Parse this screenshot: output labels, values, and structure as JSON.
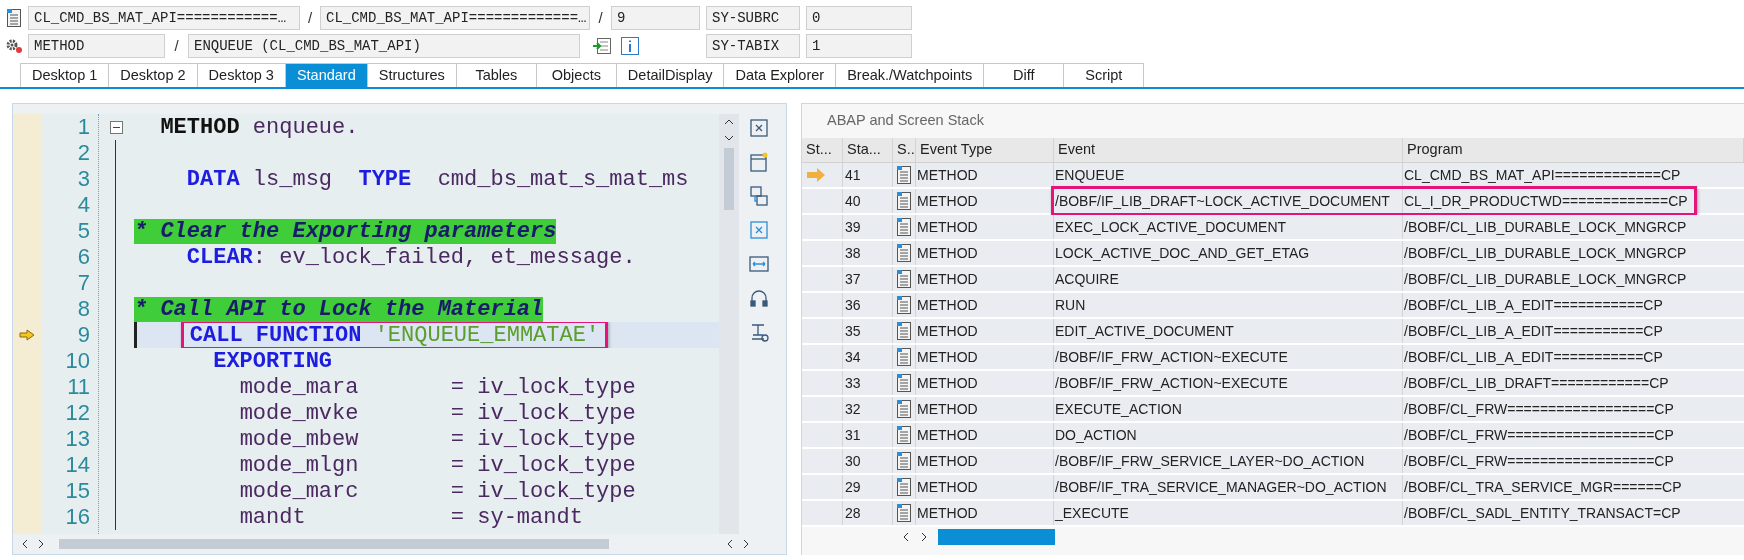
{
  "context": {
    "program_1": "CL_CMD_BS_MAT_API============…",
    "separator_1": "/",
    "program_2": "CL_CMD_BS_MAT_API=============…",
    "separator_2": "/",
    "line": "9",
    "subrc_label": "SY-SUBRC",
    "subrc_value": "0",
    "event_type": "METHOD",
    "separator_3": "/",
    "event": "ENQUEUE (CL_CMD_BS_MAT_API)",
    "tabix_label": "SY-TABIX",
    "tabix_value": "1"
  },
  "tabs": [
    {
      "label": "Desktop 1",
      "selected": false
    },
    {
      "label": "Desktop 2",
      "selected": false
    },
    {
      "label": "Desktop 3",
      "selected": false
    },
    {
      "label": "Standard",
      "selected": true
    },
    {
      "label": "Structures",
      "selected": false
    },
    {
      "label": "Tables",
      "selected": false
    },
    {
      "label": "Objects",
      "selected": false
    },
    {
      "label": "DetailDisplay",
      "selected": false
    },
    {
      "label": "Data Explorer",
      "selected": false
    },
    {
      "label": "Break./Watchpoints",
      "selected": false
    },
    {
      "label": "Diff",
      "selected": false
    },
    {
      "label": "Script",
      "selected": false
    }
  ],
  "editor": {
    "lines": [
      {
        "number": "1",
        "current": false,
        "boxed": false,
        "fold": true,
        "tokens": [
          {
            "kind": "statement",
            "text": "  METHOD"
          },
          {
            "kind": "text",
            "text": " enqueue."
          }
        ]
      },
      {
        "number": "2",
        "current": false,
        "boxed": false,
        "fold": false
      },
      {
        "number": "3",
        "current": false,
        "boxed": false,
        "fold": false,
        "tokens": [
          {
            "kind": "keyword",
            "text": "    DATA"
          },
          {
            "kind": "text",
            "text": " ls_msg  "
          },
          {
            "kind": "keyword",
            "text": "TYPE"
          },
          {
            "kind": "text",
            "text": "  cmd_bs_mat_s_mat_ms"
          }
        ]
      },
      {
        "number": "4",
        "current": false,
        "boxed": false,
        "fold": false
      },
      {
        "number": "5",
        "current": false,
        "boxed": false,
        "fold": false,
        "tokens": [
          {
            "kind": "comment",
            "text": "* Clear the Exporting parameters"
          }
        ]
      },
      {
        "number": "6",
        "current": false,
        "boxed": false,
        "fold": false,
        "tokens": [
          {
            "kind": "keyword",
            "text": "    CLEAR"
          },
          {
            "kind": "text",
            "text": ": ev_lock_failed, et_message."
          }
        ]
      },
      {
        "number": "7",
        "current": false,
        "boxed": false,
        "fold": false
      },
      {
        "number": "8",
        "current": false,
        "boxed": false,
        "fold": false,
        "tokens": [
          {
            "kind": "comment",
            "text": "* Call API to Lock the Material"
          }
        ]
      },
      {
        "number": "9",
        "current": true,
        "boxed": true,
        "fold": false,
        "tokens": [
          {
            "kind": "keyword",
            "text": "    CALL FUNCTION"
          },
          {
            "kind": "string",
            "text": " 'ENQUEUE_EMMATAE'"
          }
        ]
      },
      {
        "number": "10",
        "current": false,
        "boxed": false,
        "fold": false,
        "tokens": [
          {
            "kind": "keyword",
            "text": "      EXPORTING"
          }
        ]
      },
      {
        "number": "11",
        "current": false,
        "boxed": false,
        "fold": false,
        "tokens": [
          {
            "kind": "text",
            "text": "        mode_mara       = iv_lock_type"
          }
        ]
      },
      {
        "number": "12",
        "current": false,
        "boxed": false,
        "fold": false,
        "tokens": [
          {
            "kind": "text",
            "text": "        mode_mvke       = iv_lock_type"
          }
        ]
      },
      {
        "number": "13",
        "current": false,
        "boxed": false,
        "fold": false,
        "tokens": [
          {
            "kind": "text",
            "text": "        mode_mbew       = iv_lock_type"
          }
        ]
      },
      {
        "number": "14",
        "current": false,
        "boxed": false,
        "fold": false,
        "tokens": [
          {
            "kind": "text",
            "text": "        mode_mlgn       = iv_lock_type"
          }
        ]
      },
      {
        "number": "15",
        "current": false,
        "boxed": false,
        "fold": false,
        "tokens": [
          {
            "kind": "text",
            "text": "        mode_marc       = iv_lock_type"
          }
        ]
      },
      {
        "number": "16",
        "current": false,
        "boxed": false,
        "fold": false,
        "tokens": [
          {
            "kind": "text",
            "text": "        mandt           = sy-mandt"
          }
        ]
      }
    ]
  },
  "stack": {
    "title": "ABAP and Screen Stack",
    "columns": [
      "St...",
      "Sta...",
      "S..",
      "Event Type",
      "Event",
      "Program"
    ],
    "rows": [
      {
        "current": true,
        "boxed": false,
        "level_no": "41",
        "event_type": "METHOD",
        "event": "ENQUEUE",
        "program": "CL_CMD_BS_MAT_API=============CP"
      },
      {
        "current": false,
        "boxed": true,
        "level_no": "40",
        "event_type": "METHOD",
        "event": "/BOBF/IF_LIB_DRAFT~LOCK_ACTIVE_DOCUMENT",
        "program": "CL_I_DR_PRODUCTWD=============CP"
      },
      {
        "current": false,
        "boxed": false,
        "level_no": "39",
        "event_type": "METHOD",
        "event": "EXEC_LOCK_ACTIVE_DOCUMENT",
        "program": "/BOBF/CL_LIB_DURABLE_LOCK_MNGRCP"
      },
      {
        "current": false,
        "boxed": false,
        "level_no": "38",
        "event_type": "METHOD",
        "event": "LOCK_ACTIVE_DOC_AND_GET_ETAG",
        "program": "/BOBF/CL_LIB_DURABLE_LOCK_MNGRCP"
      },
      {
        "current": false,
        "boxed": false,
        "level_no": "37",
        "event_type": "METHOD",
        "event": "ACQUIRE",
        "program": "/BOBF/CL_LIB_DURABLE_LOCK_MNGRCP"
      },
      {
        "current": false,
        "boxed": false,
        "level_no": "36",
        "event_type": "METHOD",
        "event": "RUN",
        "program": "/BOBF/CL_LIB_A_EDIT===========CP"
      },
      {
        "current": false,
        "boxed": false,
        "level_no": "35",
        "event_type": "METHOD",
        "event": "EDIT_ACTIVE_DOCUMENT",
        "program": "/BOBF/CL_LIB_A_EDIT===========CP"
      },
      {
        "current": false,
        "boxed": false,
        "level_no": "34",
        "event_type": "METHOD",
        "event": "/BOBF/IF_FRW_ACTION~EXECUTE",
        "program": "/BOBF/CL_LIB_A_EDIT===========CP"
      },
      {
        "current": false,
        "boxed": false,
        "level_no": "33",
        "event_type": "METHOD",
        "event": "/BOBF/IF_FRW_ACTION~EXECUTE",
        "program": "/BOBF/CL_LIB_DRAFT============CP"
      },
      {
        "current": false,
        "boxed": false,
        "level_no": "32",
        "event_type": "METHOD",
        "event": "EXECUTE_ACTION",
        "program": "/BOBF/CL_FRW==================CP"
      },
      {
        "current": false,
        "boxed": false,
        "level_no": "31",
        "event_type": "METHOD",
        "event": "DO_ACTION",
        "program": "/BOBF/CL_FRW==================CP"
      },
      {
        "current": false,
        "boxed": false,
        "level_no": "30",
        "event_type": "METHOD",
        "event": "/BOBF/IF_FRW_SERVICE_LAYER~DO_ACTION",
        "program": "/BOBF/CL_FRW==================CP"
      },
      {
        "current": false,
        "boxed": false,
        "level_no": "29",
        "event_type": "METHOD",
        "event": "/BOBF/IF_TRA_SERVICE_MANAGER~DO_ACTION",
        "program": "/BOBF/CL_TRA_SERVICE_MGR======CP"
      },
      {
        "current": false,
        "boxed": false,
        "level_no": "28",
        "event_type": "METHOD",
        "event": "_EXECUTE",
        "program": "/BOBF/CL_SADL_ENTITY_TRANSACT=CP"
      }
    ]
  }
}
